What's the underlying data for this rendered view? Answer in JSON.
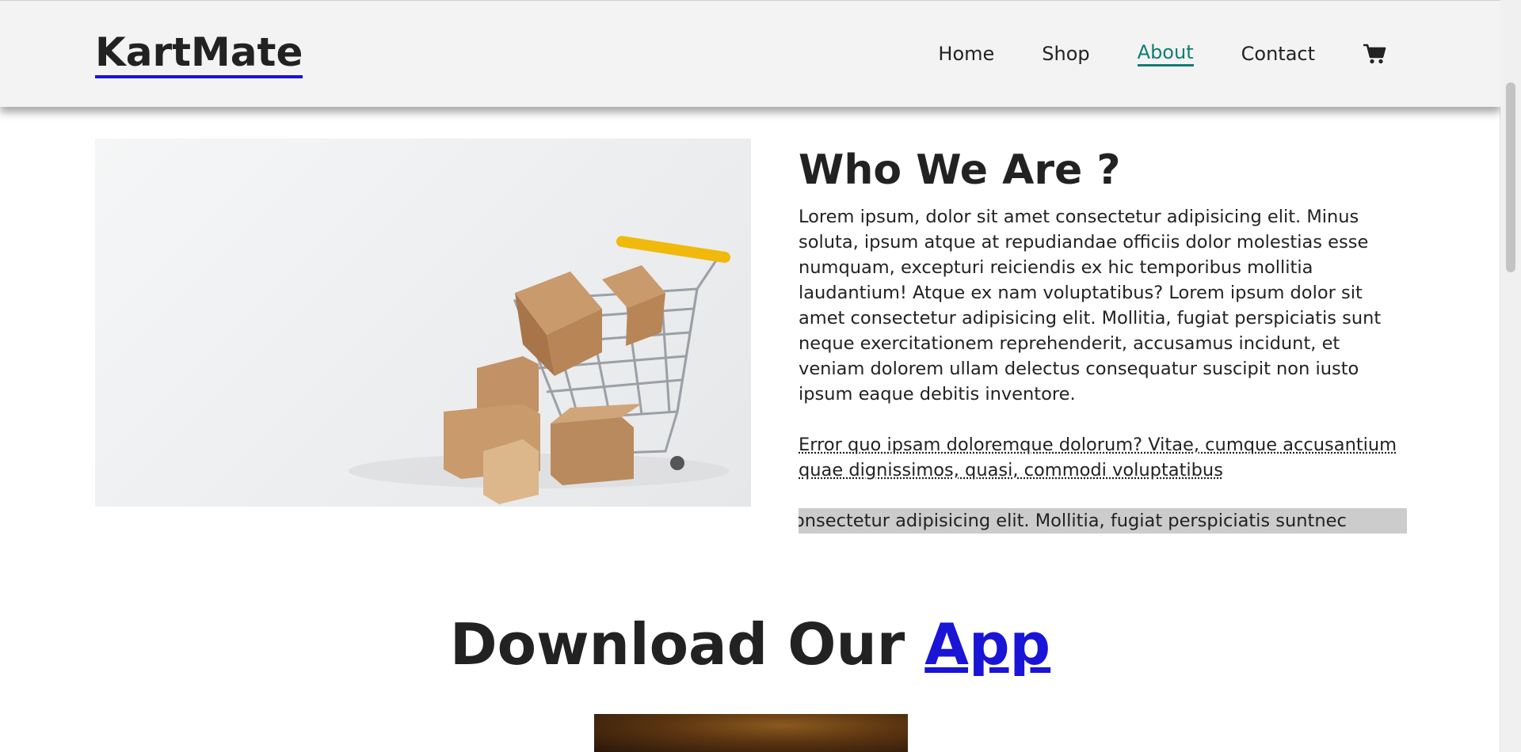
{
  "header": {
    "logo": "KartMate",
    "nav": [
      {
        "label": "Home"
      },
      {
        "label": "Shop"
      },
      {
        "label": "About",
        "active": true
      },
      {
        "label": "Contact"
      }
    ],
    "cart_icon": "shopping-cart-icon"
  },
  "about": {
    "title": "Who We Are ?",
    "paragraph": "Lorem ipsum, dolor sit amet consectetur adipisicing elit. Minus soluta, ipsum atque at repudiandae officiis dolor molestias esse numquam, excepturi reiciendis ex hic temporibus mollitia laudantium! Atque ex nam voluptatibus? Lorem ipsum dolor sit amet consectetur adipisicing elit. Mollitia, fugiat perspiciatis sunt neque exercitationem reprehenderit, accusamus incidunt, et veniam dolorem ullam delectus consequatur suscipit non iusto ipsum eaque debitis inventore.",
    "link": "Error quo ipsam doloremque dolorum? Vitae, cumque accusantium quae dignissimos, quasi, commodi voluptatibus",
    "marquee": "or sit amet consectetur adipisicing elit. Mollitia, fugiat perspiciatis suntnec"
  },
  "download": {
    "title_prefix": "Download Our ",
    "title_link": "App"
  },
  "colors": {
    "accent": "#0f7d72",
    "link_blue": "#1a14d6",
    "header_bg": "#f3f3f3",
    "marquee_bg": "#cccccc"
  }
}
